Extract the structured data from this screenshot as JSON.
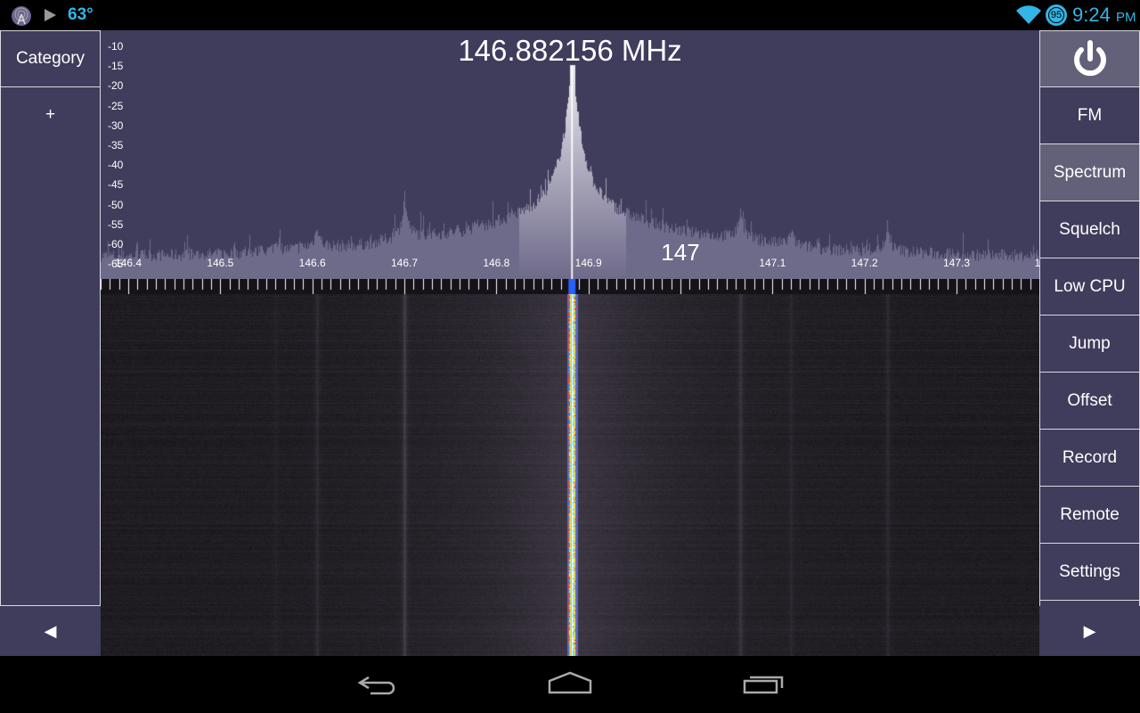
{
  "status_bar": {
    "temperature": "63°",
    "time": "9:24",
    "ampm": "PM",
    "battery_level": "95",
    "icons": [
      "radio-tower-icon",
      "play-icon",
      "wifi-icon",
      "battery-icon"
    ],
    "accent": "#33b5e5"
  },
  "left_panel": {
    "category_label": "Category",
    "add_label": "+",
    "prev_label": "◀"
  },
  "right_panel": {
    "power_icon": "power-icon",
    "items": [
      {
        "label": "FM",
        "selected": false
      },
      {
        "label": "Spectrum",
        "selected": true
      },
      {
        "label": "Squelch",
        "selected": false
      },
      {
        "label": "Low CPU",
        "selected": false
      },
      {
        "label": "Jump",
        "selected": false
      },
      {
        "label": "Offset",
        "selected": false
      },
      {
        "label": "Record",
        "selected": false
      },
      {
        "label": "Remote",
        "selected": false
      },
      {
        "label": "Settings",
        "selected": false
      }
    ],
    "next_label": "▶"
  },
  "spectrum": {
    "frequency_display": "146.882156 MHz",
    "tuned_mhz": 146.882156,
    "db_labels": [
      "-10",
      "-15",
      "-20",
      "-25",
      "-30",
      "-35",
      "-40",
      "-45",
      "-50",
      "-55",
      "-60",
      "-65"
    ],
    "db_range": [
      -65,
      -10
    ],
    "freq_labels": [
      "146.4",
      "146.5",
      "146.6",
      "146.7",
      "146.8",
      "146.9",
      "147",
      "147.1",
      "147.2",
      "147.3",
      "1"
    ],
    "freq_range_mhz": [
      146.37,
      147.39
    ],
    "background": "#403c5c"
  },
  "nav_bar": {
    "icons": [
      "back-icon",
      "home-icon",
      "recent-apps-icon"
    ]
  }
}
